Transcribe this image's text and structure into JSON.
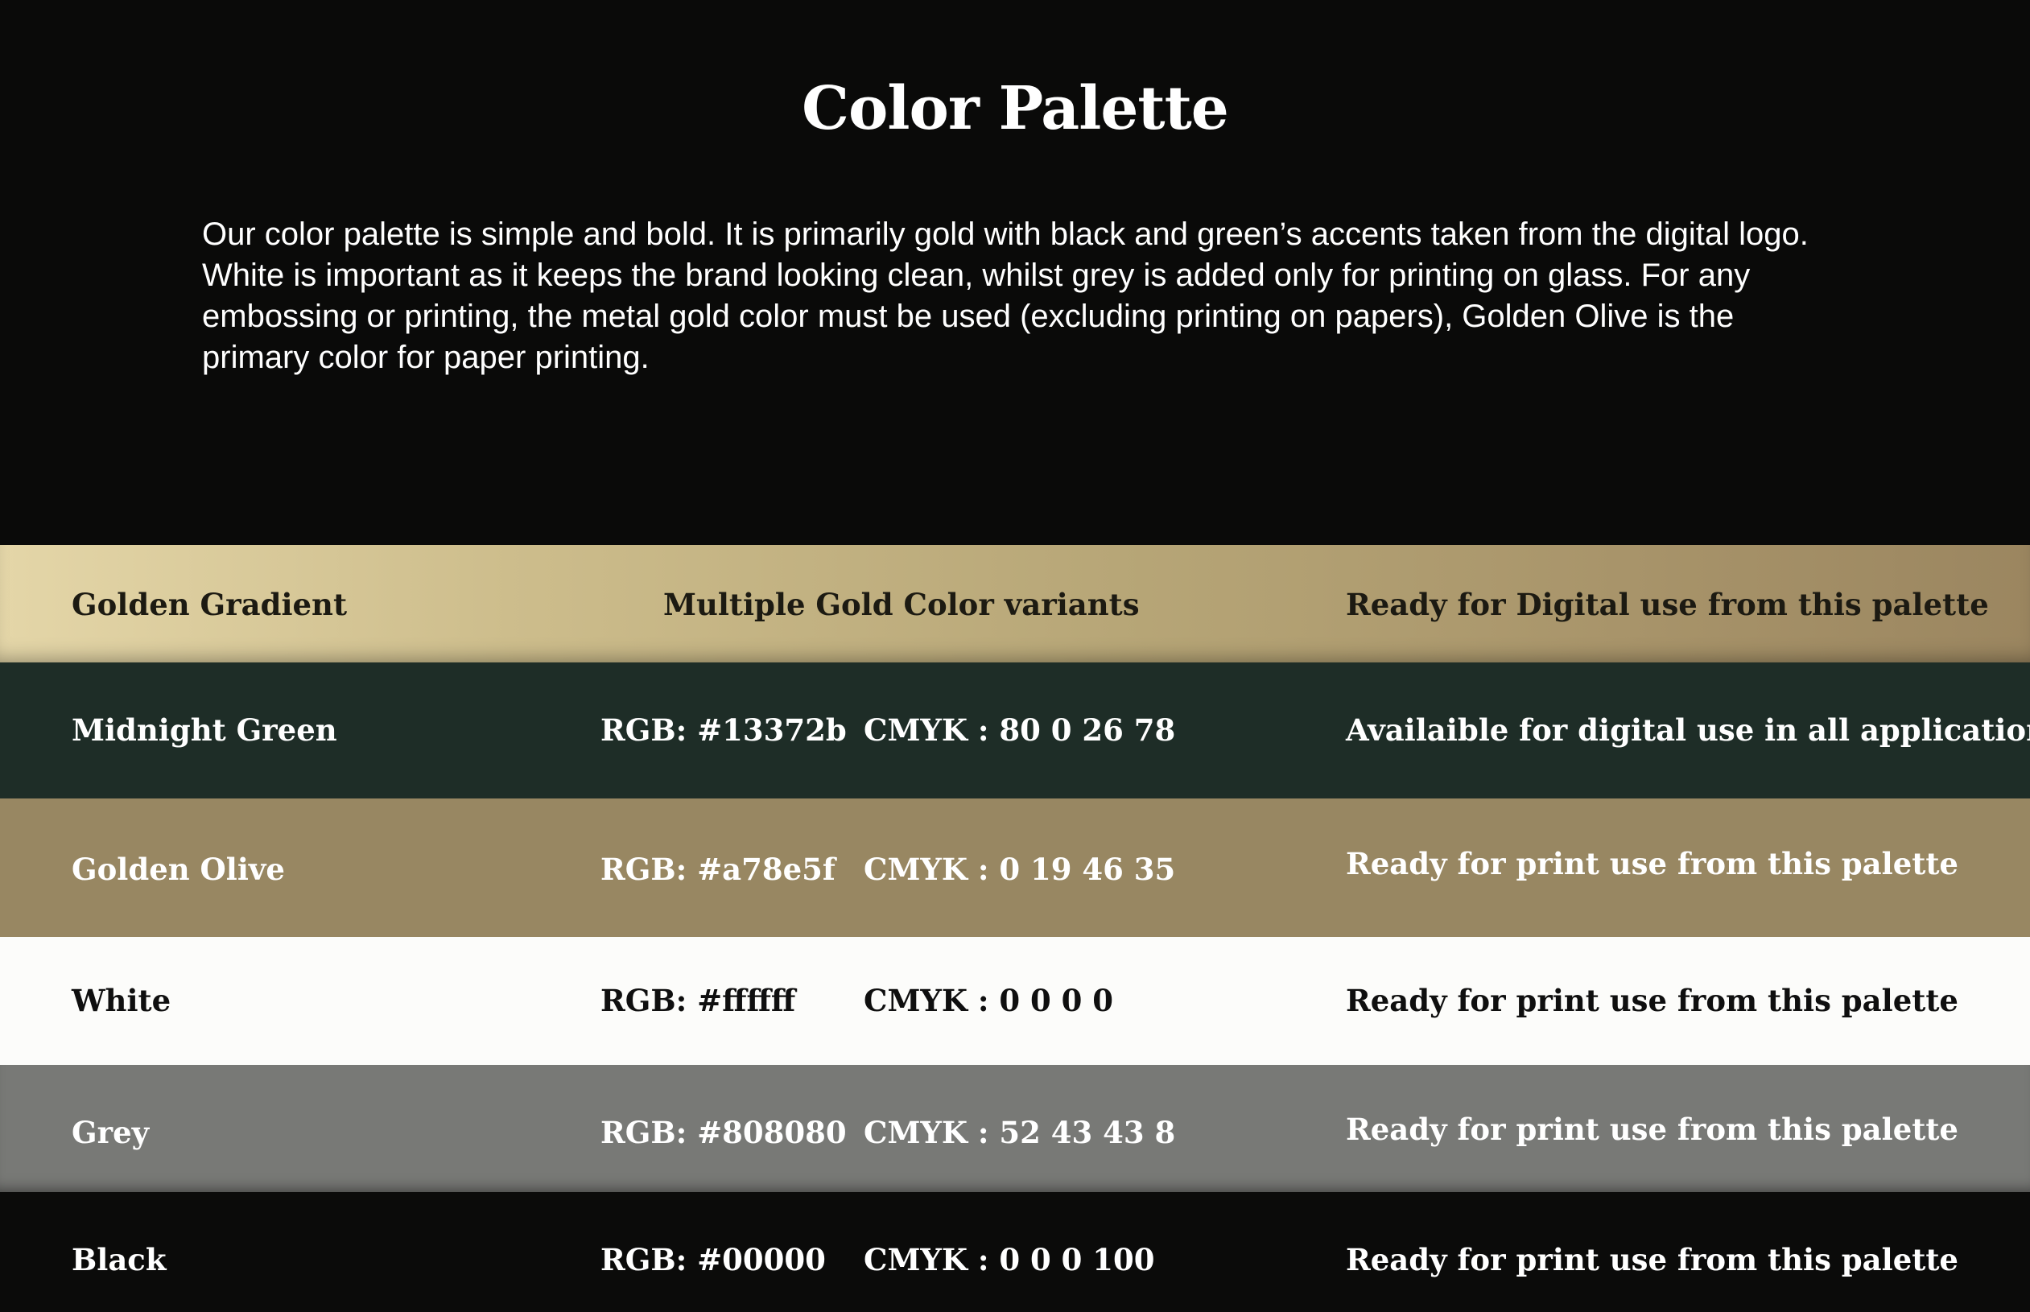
{
  "title": "Color Palette",
  "intro": "Our color palette is simple and bold. It is primarily gold with black and green’s accents taken from the digital logo. White is important as it keeps the brand looking clean, whilst grey is added only for printing on glass. For any embossing or printing, the metal gold color must be used (excluding printing on papers), Golden Olive is the primary color for paper printing.",
  "gradient_row": {
    "name": "Golden Gradient",
    "variants": "Multiple Gold Color variants",
    "use": "Ready for Digital use from this palette",
    "colors": [
      "#e4d6a8",
      "#cdbd8c",
      "#b7a677",
      "#a8946a",
      "#9b8660"
    ]
  },
  "rows": [
    {
      "name": "Midnight Green",
      "rgb": "RGB: #13372b",
      "cmyk": "CMYK : 80  0  26  78",
      "use": "Availaible for digital use in all applications",
      "swatch": "#1e2d27"
    },
    {
      "name": "Golden Olive",
      "rgb": "RGB: #a78e5f",
      "cmyk": "CMYK : 0  19  46  35",
      "use": "Ready for print use from this palette",
      "swatch": "#988762"
    },
    {
      "name": "White",
      "rgb": "RGB: #ffffff",
      "cmyk": "CMYK : 0  0  0  0",
      "use": "Ready for print use from this palette",
      "swatch": "#fcfcfa"
    },
    {
      "name": "Grey",
      "rgb": "RGB: #808080",
      "cmyk": "CMYK : 52 43 43 8",
      "use": "Ready for print use from this palette",
      "swatch": "#787976"
    },
    {
      "name": "Black",
      "rgb": "RGB: #00000",
      "cmyk": "CMYK : 0 0 0 100",
      "use": "Ready for print use from this palette",
      "swatch": "#0b0b0a"
    }
  ]
}
